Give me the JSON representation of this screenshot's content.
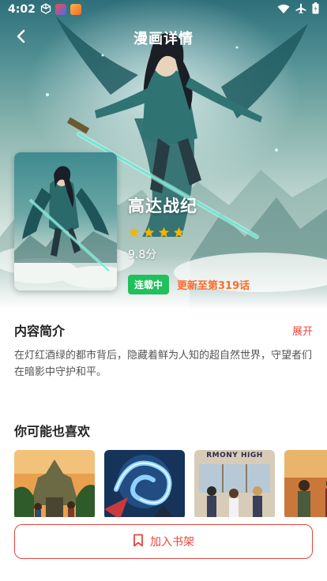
{
  "status_bar": {
    "time": "4:02",
    "left_icons": [
      "cube-icon",
      "app-icon-red",
      "app-icon-orange"
    ],
    "right_icons": [
      "wifi-icon",
      "airplane-icon",
      "battery-icon"
    ]
  },
  "header": {
    "title": "漫画详情",
    "back_icon": "chevron-left-icon"
  },
  "comic": {
    "title": "高达战纪",
    "rating_stars": 4,
    "score": "9.8分",
    "status": "连载中",
    "update": "更新至第319话"
  },
  "synopsis": {
    "title": "内容简介",
    "expand_label": "展开",
    "text": "在灯红酒绿的都市背后，隐藏着鲜为人知的超自然世界，守望者们在暗影中守护和平。"
  },
  "recommendations": {
    "title": "你可能也喜欢",
    "items": [
      {
        "theme": "jungle-temple"
      },
      {
        "theme": "blue-dragon"
      },
      {
        "theme": "school-class",
        "cover_text": "RMONY HIGH"
      },
      {
        "theme": "warriors"
      }
    ]
  },
  "bottom": {
    "shelf_label": "加入书架",
    "shelf_icon": "bookmark-icon"
  },
  "colors": {
    "accent": "#e8453c",
    "status_green": "#20c05c",
    "update_orange": "#ff6a2c",
    "star_yellow": "#f5b400"
  }
}
